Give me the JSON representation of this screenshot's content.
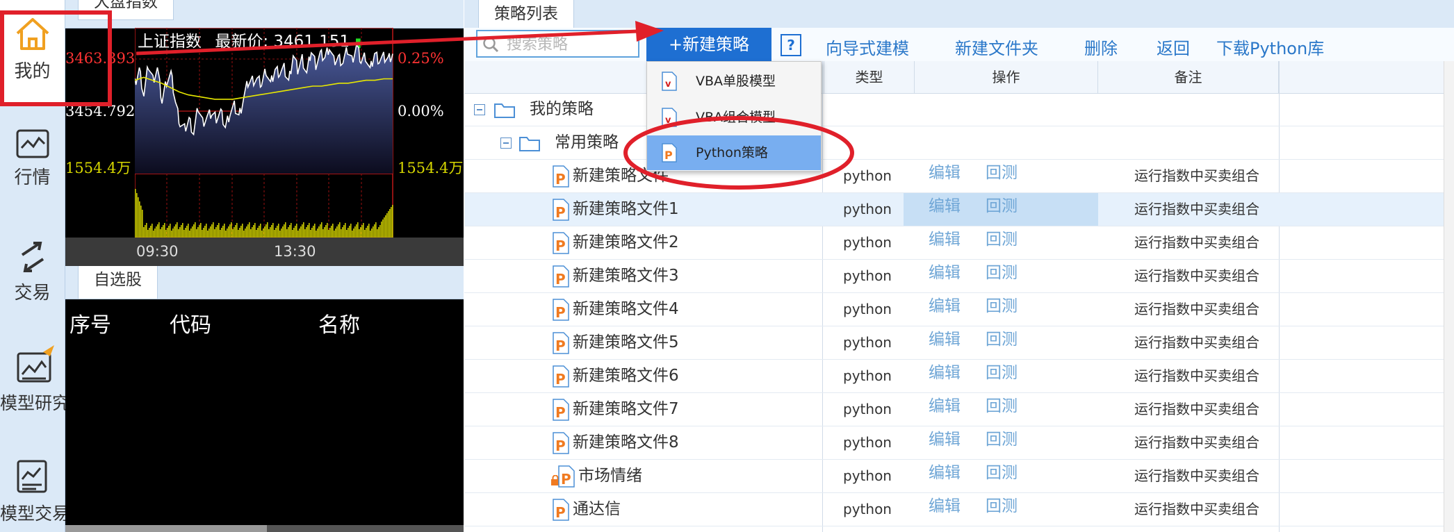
{
  "nav": {
    "items": [
      {
        "id": "mine",
        "label": "我的"
      },
      {
        "id": "market",
        "label": "行情"
      },
      {
        "id": "trade",
        "label": "交易"
      },
      {
        "id": "research",
        "label": "模型研究"
      },
      {
        "id": "modeltrade",
        "label": "模型交易"
      }
    ]
  },
  "market": {
    "tab": "大盘指数",
    "index_name": "上证指数",
    "latest_label": "最新价:",
    "latest_value": "3461.151",
    "price_top": "3463.393",
    "price_mid": "3454.792",
    "price_bottom": "1554.4万",
    "pct_top": "0.25%",
    "pct_mid": "0.00%",
    "vol_right": "1554.4万",
    "times": [
      "09:30",
      "13:30"
    ],
    "colors": {
      "up": "#ff3333",
      "flat": "#ffffff",
      "volume": "#c8c800",
      "avg": "#e8e800"
    }
  },
  "watchlist": {
    "tab": "自选股",
    "columns": [
      "序号",
      "代码",
      "名称"
    ]
  },
  "strategy": {
    "tab": "策略列表",
    "search_placeholder": "搜索策略",
    "new_button": "+新建策略",
    "help": "?",
    "links": [
      "向导式建模",
      "新建文件夹",
      "删除",
      "返回",
      "下载Python库"
    ],
    "headers": {
      "type": "类型",
      "ops": "操作",
      "note": "备注"
    },
    "tree": {
      "root": "我的策略",
      "folder": "常用策略"
    },
    "rows": [
      {
        "name": "新建策略文件",
        "type": "python",
        "edit": "编辑",
        "backtest": "回测",
        "note": "运行指数中买卖组合"
      },
      {
        "name": "新建策略文件1",
        "type": "python",
        "edit": "编辑",
        "backtest": "回测",
        "note": "运行指数中买卖组合"
      },
      {
        "name": "新建策略文件2",
        "type": "python",
        "edit": "编辑",
        "backtest": "回测",
        "note": "运行指数中买卖组合"
      },
      {
        "name": "新建策略文件3",
        "type": "python",
        "edit": "编辑",
        "backtest": "回测",
        "note": "运行指数中买卖组合"
      },
      {
        "name": "新建策略文件4",
        "type": "python",
        "edit": "编辑",
        "backtest": "回测",
        "note": "运行指数中买卖组合"
      },
      {
        "name": "新建策略文件5",
        "type": "python",
        "edit": "编辑",
        "backtest": "回测",
        "note": "运行指数中买卖组合"
      },
      {
        "name": "新建策略文件6",
        "type": "python",
        "edit": "编辑",
        "backtest": "回测",
        "note": "运行指数中买卖组合"
      },
      {
        "name": "新建策略文件7",
        "type": "python",
        "edit": "编辑",
        "backtest": "回测",
        "note": "运行指数中买卖组合"
      },
      {
        "name": "新建策略文件8",
        "type": "python",
        "edit": "编辑",
        "backtest": "回测",
        "note": "运行指数中买卖组合"
      },
      {
        "name": "市场情绪",
        "type": "python",
        "edit": "编辑",
        "backtest": "回测",
        "note": "运行指数中买卖组合",
        "locked": true
      },
      {
        "name": "通达信",
        "type": "python",
        "edit": "编辑",
        "backtest": "回测",
        "note": "运行指数中买卖组合"
      }
    ],
    "selected_row": 1,
    "dropdown": [
      {
        "label": "VBA单股模型",
        "icon": "vba-icon"
      },
      {
        "label": "VBA组合模型",
        "icon": "vba-icon"
      },
      {
        "label": "Python策略",
        "icon": "python-icon"
      }
    ],
    "dropdown_selected": 2,
    "colors": {
      "accent": "#1e6fd2",
      "link": "#2b78c9",
      "highlight": "#78aef0",
      "annotation": "#e0202a"
    }
  }
}
